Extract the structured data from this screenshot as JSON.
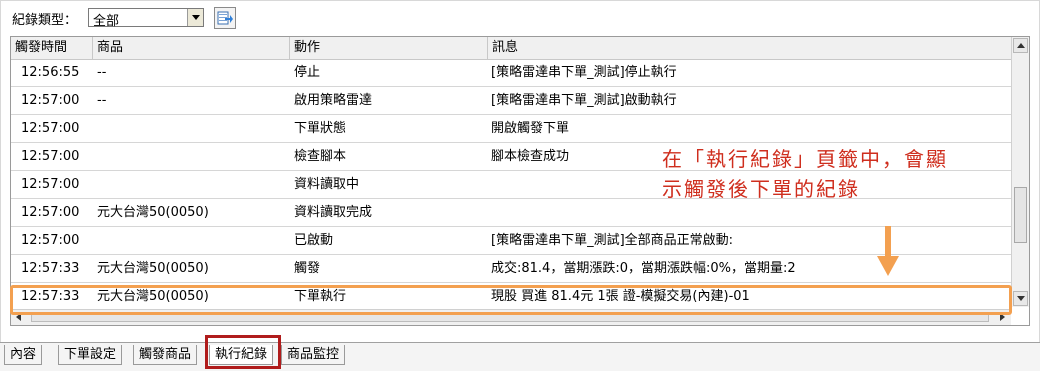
{
  "toolbar": {
    "record_type_label": "紀錄類型：",
    "record_type_value": "全部",
    "export_icon": "export-icon"
  },
  "columns": [
    "觸發時間",
    "商品",
    "動作",
    "訊息"
  ],
  "rows": [
    {
      "time": "12:56:55",
      "product": "--",
      "action": "停止",
      "message": "[策略雷達串下單_測試]停止執行"
    },
    {
      "time": "12:57:00",
      "product": "--",
      "action": "啟用策略雷達",
      "message": "[策略雷達串下單_測試]啟動執行"
    },
    {
      "time": "12:57:00",
      "product": "",
      "action": "下單狀態",
      "message": "開啟觸發下單"
    },
    {
      "time": "12:57:00",
      "product": "",
      "action": "檢查腳本",
      "message": "腳本檢查成功"
    },
    {
      "time": "12:57:00",
      "product": "",
      "action": "資料讀取中",
      "message": ""
    },
    {
      "time": "12:57:00",
      "product": "元大台灣50(0050)",
      "action": "資料讀取完成",
      "message": ""
    },
    {
      "time": "12:57:00",
      "product": "",
      "action": "已啟動",
      "message": "[策略雷達串下單_測試]全部商品正常啟動:"
    },
    {
      "time": "12:57:33",
      "product": "元大台灣50(0050)",
      "action": "觸發",
      "message": "成交:81.4，當期漲跌:0，當期漲跌幅:0%，當期量:2"
    },
    {
      "time": "12:57:33",
      "product": "元大台灣50(0050)",
      "action": "下單執行",
      "message": "現股 買進 81.4元 1張 證-模擬交易(內建)-01"
    }
  ],
  "annotation": {
    "line1": "在「執行紀錄」頁籤中，會顯",
    "line2": "示觸發後下單的紀錄",
    "color": "#cf2e1e",
    "highlight_color": "#f3a050"
  },
  "tabs": [
    {
      "label": "內容",
      "active": false
    },
    {
      "label": "下單設定",
      "active": false
    },
    {
      "label": "觸發商品",
      "active": false
    },
    {
      "label": "執行紀錄",
      "active": true
    },
    {
      "label": "商品監控",
      "active": false
    }
  ]
}
